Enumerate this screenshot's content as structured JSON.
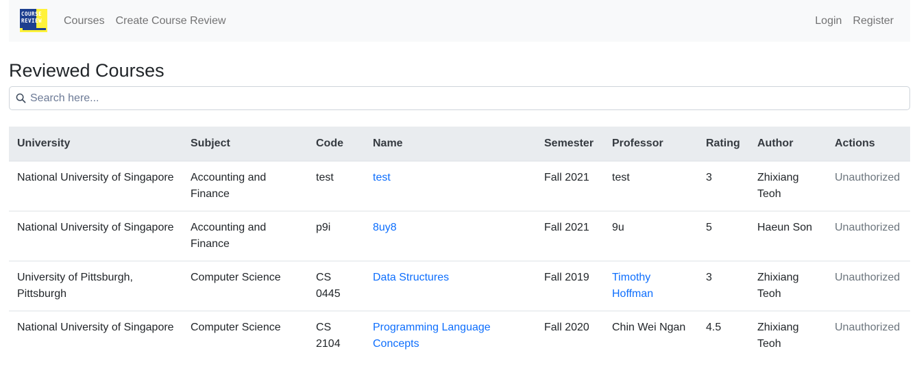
{
  "navbar": {
    "logo_line1": "COURSE",
    "logo_line2": "REVIEW",
    "links_left": [
      "Courses",
      "Create Course Review"
    ],
    "links_right": [
      "Login",
      "Register"
    ]
  },
  "page": {
    "title": "Reviewed Courses"
  },
  "search": {
    "placeholder": "Search here...",
    "value": ""
  },
  "table": {
    "columns": [
      "University",
      "Subject",
      "Code",
      "Name",
      "Semester",
      "Professor",
      "Rating",
      "Author",
      "Actions"
    ],
    "rows": [
      {
        "university": "National University of Singapore",
        "subject": "Accounting and Finance",
        "code": "test",
        "name": "test",
        "semester": "Fall 2021",
        "professor": "test",
        "professor_link": false,
        "rating": "3",
        "author": "Zhixiang Teoh",
        "actions": "Unauthorized"
      },
      {
        "university": "National University of Singapore",
        "subject": "Accounting and Finance",
        "code": "p9i",
        "name": "8uy8",
        "semester": "Fall 2021",
        "professor": "9u",
        "professor_link": false,
        "rating": "5",
        "author": "Haeun Son",
        "actions": "Unauthorized"
      },
      {
        "university": "University of Pittsburgh, Pittsburgh",
        "subject": "Computer Science",
        "code": "CS 0445",
        "name": "Data Structures",
        "semester": "Fall 2019",
        "professor": "Timothy Hoffman",
        "professor_link": true,
        "rating": "3",
        "author": "Zhixiang Teoh",
        "actions": "Unauthorized"
      },
      {
        "university": "National University of Singapore",
        "subject": "Computer Science",
        "code": "CS 2104",
        "name": "Programming Language Concepts",
        "semester": "Fall 2020",
        "professor": "Chin Wei Ngan",
        "professor_link": false,
        "rating": "4.5",
        "author": "Zhixiang Teoh",
        "actions": "Unauthorized"
      }
    ]
  },
  "colors": {
    "navbar_bg": "#f8f9fa",
    "header_bg": "#e9ecef",
    "link": "#0d6efd",
    "muted": "#6c757d",
    "logo_yellow": "#fff23a",
    "logo_blue": "#1d3f8f"
  },
  "icons": {
    "search": "search-icon"
  }
}
